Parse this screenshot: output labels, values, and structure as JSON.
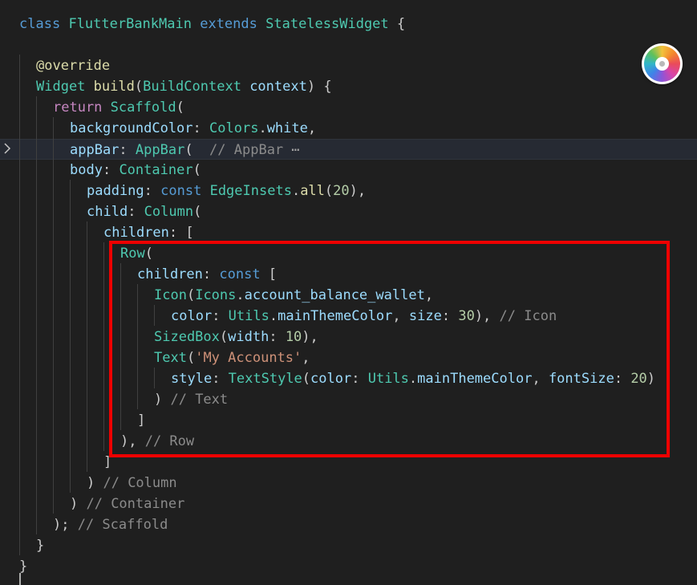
{
  "editor": {
    "lines": [
      {
        "tokens": [
          {
            "t": "class",
            "c": "kw"
          },
          {
            "t": " ",
            "c": "pun"
          },
          {
            "t": "FlutterBankMain",
            "c": "cls"
          },
          {
            "t": " ",
            "c": "pun"
          },
          {
            "t": "extends",
            "c": "kw"
          },
          {
            "t": " ",
            "c": "pun"
          },
          {
            "t": "StatelessWidget",
            "c": "cls"
          },
          {
            "t": " {",
            "c": "pun"
          }
        ]
      },
      {
        "tokens": []
      },
      {
        "tokens": [
          {
            "t": "@override",
            "c": "fn"
          }
        ]
      },
      {
        "tokens": [
          {
            "t": "Widget",
            "c": "cls"
          },
          {
            "t": " ",
            "c": "pun"
          },
          {
            "t": "build",
            "c": "fn"
          },
          {
            "t": "(",
            "c": "pun"
          },
          {
            "t": "BuildContext",
            "c": "cls"
          },
          {
            "t": " ",
            "c": "pun"
          },
          {
            "t": "context",
            "c": "prm"
          },
          {
            "t": ") {",
            "c": "pun"
          }
        ]
      },
      {
        "tokens": [
          {
            "t": "return",
            "c": "ctl"
          },
          {
            "t": " ",
            "c": "pun"
          },
          {
            "t": "Scaffold",
            "c": "cls"
          },
          {
            "t": "(",
            "c": "pun"
          }
        ]
      },
      {
        "tokens": [
          {
            "t": "backgroundColor",
            "c": "prm"
          },
          {
            "t": ": ",
            "c": "pun"
          },
          {
            "t": "Colors",
            "c": "cls"
          },
          {
            "t": ".",
            "c": "pun"
          },
          {
            "t": "white",
            "c": "prm"
          },
          {
            "t": ",",
            "c": "pun"
          }
        ]
      },
      {
        "tokens": [
          {
            "t": "appBar",
            "c": "prm"
          },
          {
            "t": ": ",
            "c": "pun"
          },
          {
            "t": "AppBar",
            "c": "cls"
          },
          {
            "t": "(  ",
            "c": "pun"
          },
          {
            "t": "// AppBar",
            "c": "cmt"
          },
          {
            "t": " ⋯",
            "c": "ell"
          }
        ]
      },
      {
        "tokens": [
          {
            "t": "body",
            "c": "prm"
          },
          {
            "t": ": ",
            "c": "pun"
          },
          {
            "t": "Container",
            "c": "cls"
          },
          {
            "t": "(",
            "c": "pun"
          }
        ]
      },
      {
        "tokens": [
          {
            "t": "padding",
            "c": "prm"
          },
          {
            "t": ": ",
            "c": "pun"
          },
          {
            "t": "const",
            "c": "kw"
          },
          {
            "t": " ",
            "c": "pun"
          },
          {
            "t": "EdgeInsets",
            "c": "cls"
          },
          {
            "t": ".",
            "c": "pun"
          },
          {
            "t": "all",
            "c": "fn"
          },
          {
            "t": "(",
            "c": "pun"
          },
          {
            "t": "20",
            "c": "num"
          },
          {
            "t": "),",
            "c": "pun"
          }
        ]
      },
      {
        "tokens": [
          {
            "t": "child",
            "c": "prm"
          },
          {
            "t": ": ",
            "c": "pun"
          },
          {
            "t": "Column",
            "c": "cls"
          },
          {
            "t": "(",
            "c": "pun"
          }
        ]
      },
      {
        "tokens": [
          {
            "t": "children",
            "c": "prm"
          },
          {
            "t": ": [",
            "c": "pun"
          }
        ]
      },
      {
        "tokens": [
          {
            "t": "Row",
            "c": "cls"
          },
          {
            "t": "(",
            "c": "pun"
          }
        ]
      },
      {
        "tokens": [
          {
            "t": "children",
            "c": "prm"
          },
          {
            "t": ": ",
            "c": "pun"
          },
          {
            "t": "const",
            "c": "kw"
          },
          {
            "t": " [",
            "c": "pun"
          }
        ]
      },
      {
        "tokens": [
          {
            "t": "Icon",
            "c": "cls"
          },
          {
            "t": "(",
            "c": "pun"
          },
          {
            "t": "Icons",
            "c": "cls"
          },
          {
            "t": ".",
            "c": "pun"
          },
          {
            "t": "account_balance_wallet",
            "c": "prm"
          },
          {
            "t": ",",
            "c": "pun"
          }
        ]
      },
      {
        "tokens": [
          {
            "t": "color",
            "c": "prm"
          },
          {
            "t": ": ",
            "c": "pun"
          },
          {
            "t": "Utils",
            "c": "cls"
          },
          {
            "t": ".",
            "c": "pun"
          },
          {
            "t": "mainThemeColor",
            "c": "prm"
          },
          {
            "t": ", ",
            "c": "pun"
          },
          {
            "t": "size",
            "c": "prm"
          },
          {
            "t": ": ",
            "c": "pun"
          },
          {
            "t": "30",
            "c": "num"
          },
          {
            "t": "), ",
            "c": "pun"
          },
          {
            "t": "// Icon",
            "c": "cmt"
          }
        ]
      },
      {
        "tokens": [
          {
            "t": "SizedBox",
            "c": "cls"
          },
          {
            "t": "(",
            "c": "pun"
          },
          {
            "t": "width",
            "c": "prm"
          },
          {
            "t": ": ",
            "c": "pun"
          },
          {
            "t": "10",
            "c": "num"
          },
          {
            "t": "),",
            "c": "pun"
          }
        ]
      },
      {
        "tokens": [
          {
            "t": "Text",
            "c": "cls"
          },
          {
            "t": "(",
            "c": "pun"
          },
          {
            "t": "'My Accounts'",
            "c": "str"
          },
          {
            "t": ",",
            "c": "pun"
          }
        ]
      },
      {
        "tokens": [
          {
            "t": "style",
            "c": "prm"
          },
          {
            "t": ": ",
            "c": "pun"
          },
          {
            "t": "TextStyle",
            "c": "cls"
          },
          {
            "t": "(",
            "c": "pun"
          },
          {
            "t": "color",
            "c": "prm"
          },
          {
            "t": ": ",
            "c": "pun"
          },
          {
            "t": "Utils",
            "c": "cls"
          },
          {
            "t": ".",
            "c": "pun"
          },
          {
            "t": "mainThemeColor",
            "c": "prm"
          },
          {
            "t": ", ",
            "c": "pun"
          },
          {
            "t": "fontSize",
            "c": "prm"
          },
          {
            "t": ": ",
            "c": "pun"
          },
          {
            "t": "20",
            "c": "num"
          },
          {
            "t": ")",
            "c": "pun"
          }
        ]
      },
      {
        "tokens": [
          {
            "t": ") ",
            "c": "pun"
          },
          {
            "t": "// Text",
            "c": "cmt"
          }
        ]
      },
      {
        "tokens": [
          {
            "t": "]",
            "c": "pun"
          }
        ]
      },
      {
        "tokens": [
          {
            "t": "), ",
            "c": "pun"
          },
          {
            "t": "// Row",
            "c": "cmt"
          }
        ]
      },
      {
        "tokens": [
          {
            "t": "]",
            "c": "pun"
          }
        ]
      },
      {
        "tokens": [
          {
            "t": ") ",
            "c": "pun"
          },
          {
            "t": "// Column",
            "c": "cmt"
          }
        ]
      },
      {
        "tokens": [
          {
            "t": ") ",
            "c": "pun"
          },
          {
            "t": "// Container",
            "c": "cmt"
          }
        ]
      },
      {
        "tokens": [
          {
            "t": "); ",
            "c": "pun"
          },
          {
            "t": "// Scaffold",
            "c": "cmt"
          }
        ]
      },
      {
        "tokens": [
          {
            "t": "}",
            "c": "pun"
          }
        ]
      },
      {
        "tokens": [
          {
            "t": "}",
            "c": "pun"
          }
        ]
      }
    ],
    "highlight_color": "#ee0000"
  },
  "icons": {
    "fold": "chevron-right-icon",
    "color_picker": "color-wheel-icon"
  }
}
